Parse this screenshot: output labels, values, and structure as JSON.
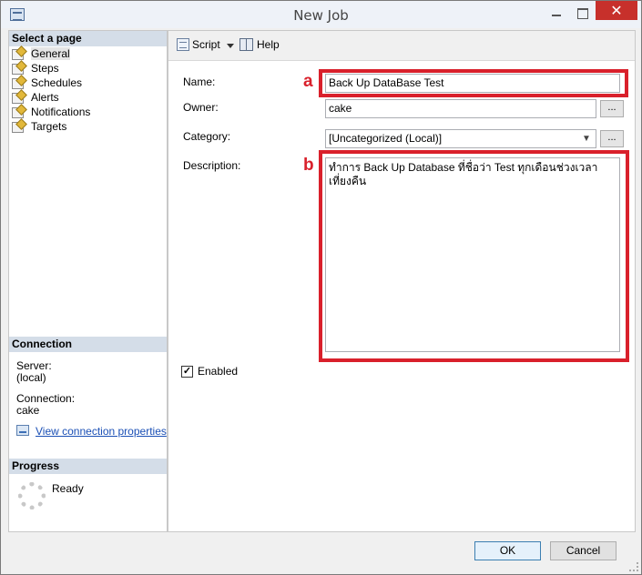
{
  "window": {
    "title": "New Job",
    "close_glyph": "✕"
  },
  "sidebar": {
    "select_page_header": "Select a page",
    "pages": [
      {
        "label": "General",
        "selected": true
      },
      {
        "label": "Steps"
      },
      {
        "label": "Schedules"
      },
      {
        "label": "Alerts"
      },
      {
        "label": "Notifications"
      },
      {
        "label": "Targets"
      }
    ],
    "connection": {
      "header": "Connection",
      "server_label": "Server:",
      "server_value": "(local)",
      "connection_label": "Connection:",
      "connection_value": "cake",
      "view_properties_link": "View connection properties"
    },
    "progress": {
      "header": "Progress",
      "status": "Ready"
    }
  },
  "toolbar": {
    "script_label": "Script",
    "help_label": "Help"
  },
  "form": {
    "name_label": "Name:",
    "name_value": "Back Up DataBase Test",
    "owner_label": "Owner:",
    "owner_value": "cake",
    "category_label": "Category:",
    "category_value": "[Uncategorized (Local)]",
    "description_label": "Description:",
    "description_value": "ทำการ Back Up Database ที่ชื่อว่า Test ทุกเดือนช่วงเวลาเที่ยงคืน",
    "browse_label": "...",
    "enabled_label": "Enabled",
    "enabled_checked": true,
    "check_glyph": "✓"
  },
  "annotations": {
    "a": "a",
    "b": "b",
    "color": "#d9202b"
  },
  "buttons": {
    "ok": "OK",
    "cancel": "Cancel"
  }
}
